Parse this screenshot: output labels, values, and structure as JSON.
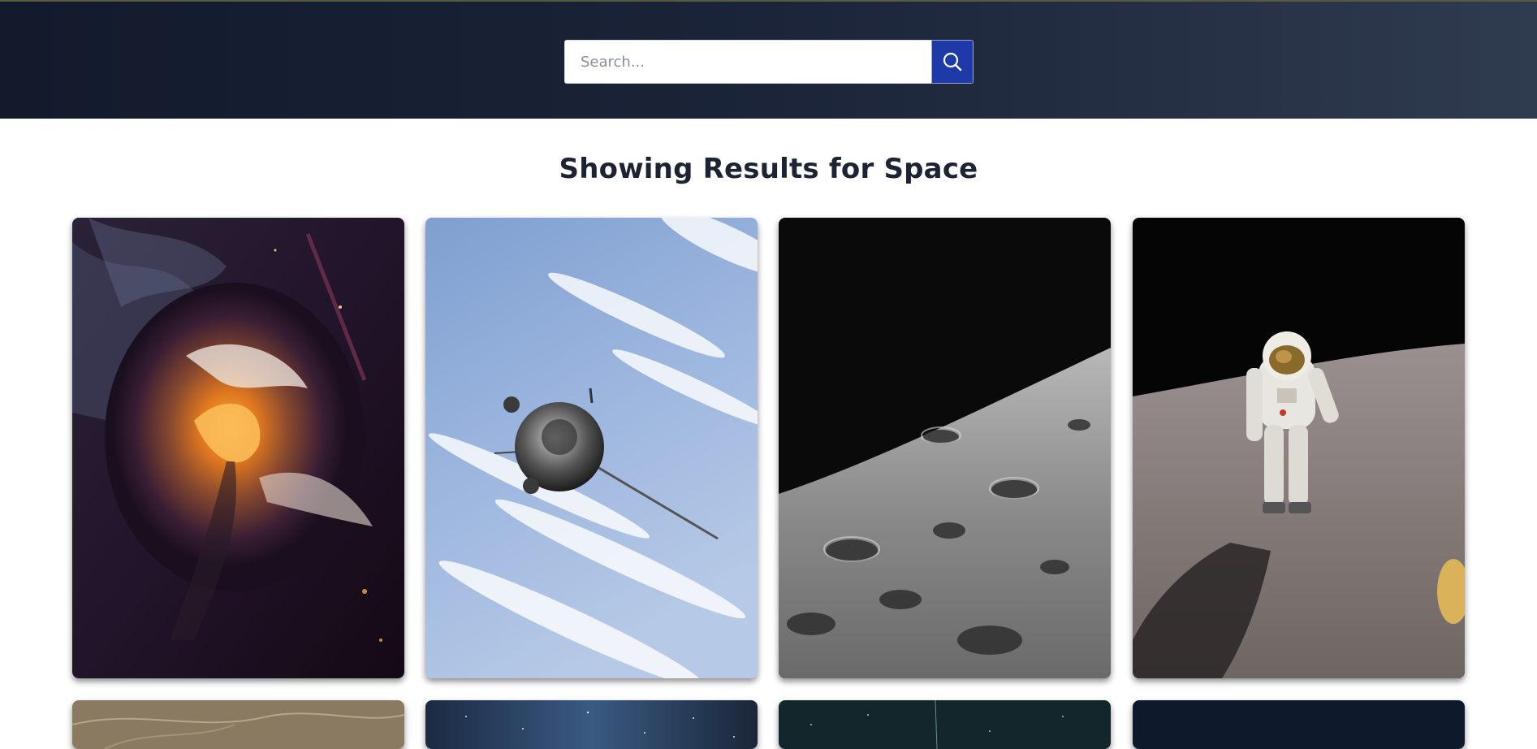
{
  "search": {
    "placeholder": "Search...",
    "value": ""
  },
  "results": {
    "title": "Showing Results for Space"
  },
  "gallery": {
    "images": [
      {
        "subject": "orange nebula swirl"
      },
      {
        "subject": "satellite above clouds"
      },
      {
        "subject": "cratered lunar surface"
      },
      {
        "subject": "astronaut on the moon"
      },
      {
        "subject": "brown textured surface"
      },
      {
        "subject": "starry night sky"
      },
      {
        "subject": "dark teal starfield"
      },
      {
        "subject": "dark navy sky"
      }
    ]
  },
  "colors": {
    "header_start": "#121a2c",
    "header_end": "#2f3b4f",
    "search_button": "#1e3aa8",
    "title_text": "#1c2333"
  },
  "icons": {
    "search_button_icon": "search-icon"
  }
}
